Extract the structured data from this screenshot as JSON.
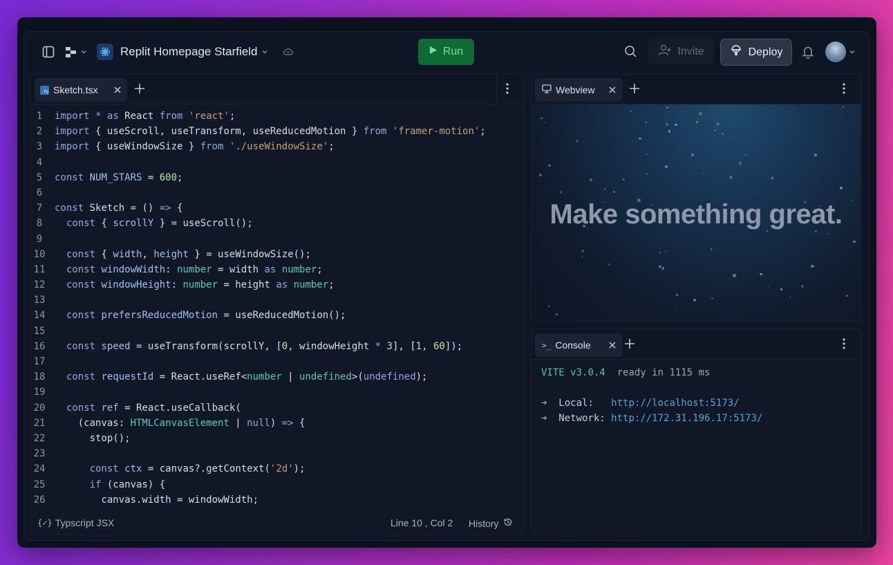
{
  "topbar": {
    "project_name": "Replit Homepage Starfield",
    "run_label": "Run",
    "invite_label": "Invite",
    "deploy_label": "Deploy"
  },
  "editor": {
    "tab_label": "Sketch.tsx",
    "language": "Typscript JSX",
    "cursor": "Line 10 , Col 2",
    "history_label": "History",
    "line_numbers": [
      "1",
      "2",
      "3",
      "4",
      "5",
      "6",
      "7",
      "8",
      "9",
      "10",
      "11",
      "12",
      "13",
      "14",
      "15",
      "16",
      "17",
      "18",
      "19",
      "20",
      "21",
      "22",
      "23",
      "24",
      "25",
      "26"
    ],
    "lines": [
      [
        [
          "kw",
          "import"
        ],
        [
          "pl",
          " "
        ],
        [
          "op",
          "*"
        ],
        [
          "pl",
          " "
        ],
        [
          "kw",
          "as"
        ],
        [
          "pl",
          " React "
        ],
        [
          "kw",
          "from"
        ],
        [
          "pl",
          " "
        ],
        [
          "str",
          "'react'"
        ],
        [
          "pl",
          ";"
        ]
      ],
      [
        [
          "kw",
          "import"
        ],
        [
          "pl",
          " { useScroll, useTransform, useReducedMotion } "
        ],
        [
          "kw",
          "from"
        ],
        [
          "pl",
          " "
        ],
        [
          "str",
          "'framer-motion'"
        ],
        [
          "pl",
          ";"
        ]
      ],
      [
        [
          "kw",
          "import"
        ],
        [
          "pl",
          " { useWindowSize } "
        ],
        [
          "kw",
          "from"
        ],
        [
          "pl",
          " "
        ],
        [
          "str",
          "'./useWindowSize'"
        ],
        [
          "pl",
          ";"
        ]
      ],
      [],
      [
        [
          "kw",
          "const"
        ],
        [
          "pl",
          " "
        ],
        [
          "vr",
          "NUM_STARS"
        ],
        [
          "pl",
          " = "
        ],
        [
          "num",
          "600"
        ],
        [
          "pl",
          ";"
        ]
      ],
      [],
      [
        [
          "kw",
          "const"
        ],
        [
          "pl",
          " Sketch = () "
        ],
        [
          "op",
          "=>"
        ],
        [
          "pl",
          " {"
        ]
      ],
      [
        [
          "pl",
          "  "
        ],
        [
          "kw",
          "const"
        ],
        [
          "pl",
          " { "
        ],
        [
          "vr",
          "scrollY"
        ],
        [
          "pl",
          " } = useScroll();"
        ]
      ],
      [],
      [
        [
          "pl",
          "  "
        ],
        [
          "kw",
          "const"
        ],
        [
          "pl",
          " { "
        ],
        [
          "vr",
          "width"
        ],
        [
          "pl",
          ", "
        ],
        [
          "vr",
          "height"
        ],
        [
          "pl",
          " } = useWindowSize();"
        ]
      ],
      [
        [
          "pl",
          "  "
        ],
        [
          "kw",
          "const"
        ],
        [
          "pl",
          " "
        ],
        [
          "vr",
          "windowWidth"
        ],
        [
          "pl",
          ": "
        ],
        [
          "ty",
          "number"
        ],
        [
          "pl",
          " = width "
        ],
        [
          "kw",
          "as"
        ],
        [
          "pl",
          " "
        ],
        [
          "ty",
          "number"
        ],
        [
          "pl",
          ";"
        ]
      ],
      [
        [
          "pl",
          "  "
        ],
        [
          "kw",
          "const"
        ],
        [
          "pl",
          " "
        ],
        [
          "vr",
          "windowHeight"
        ],
        [
          "pl",
          ": "
        ],
        [
          "ty",
          "number"
        ],
        [
          "pl",
          " = height "
        ],
        [
          "kw",
          "as"
        ],
        [
          "pl",
          " "
        ],
        [
          "ty",
          "number"
        ],
        [
          "pl",
          ";"
        ]
      ],
      [],
      [
        [
          "pl",
          "  "
        ],
        [
          "kw",
          "const"
        ],
        [
          "pl",
          " "
        ],
        [
          "vr",
          "prefersReducedMotion"
        ],
        [
          "pl",
          " = useReducedMotion();"
        ]
      ],
      [],
      [
        [
          "pl",
          "  "
        ],
        [
          "kw",
          "const"
        ],
        [
          "pl",
          " "
        ],
        [
          "vr",
          "speed"
        ],
        [
          "pl",
          " = useTransform(scrollY, ["
        ],
        [
          "num",
          "0"
        ],
        [
          "pl",
          ", windowHeight "
        ],
        [
          "op",
          "*"
        ],
        [
          "pl",
          " "
        ],
        [
          "num",
          "3"
        ],
        [
          "pl",
          "], ["
        ],
        [
          "num",
          "1"
        ],
        [
          "pl",
          ", "
        ],
        [
          "num",
          "60"
        ],
        [
          "pl",
          "]);"
        ]
      ],
      [],
      [
        [
          "pl",
          "  "
        ],
        [
          "kw",
          "const"
        ],
        [
          "pl",
          " "
        ],
        [
          "vr",
          "requestId"
        ],
        [
          "pl",
          " = React.useRef<"
        ],
        [
          "ty",
          "number"
        ],
        [
          "pl",
          " | "
        ],
        [
          "ty",
          "undefined"
        ],
        [
          "pl",
          ">("
        ],
        [
          "kw",
          "undefined"
        ],
        [
          "pl",
          ");"
        ]
      ],
      [],
      [
        [
          "pl",
          "  "
        ],
        [
          "kw",
          "const"
        ],
        [
          "pl",
          " "
        ],
        [
          "vr",
          "ref"
        ],
        [
          "pl",
          " = React.useCallback("
        ]
      ],
      [
        [
          "pl",
          "    (canvas: "
        ],
        [
          "ty",
          "HTMLCanvasElement"
        ],
        [
          "pl",
          " | "
        ],
        [
          "kw",
          "null"
        ],
        [
          "pl",
          ") "
        ],
        [
          "op",
          "=>"
        ],
        [
          "pl",
          " {"
        ]
      ],
      [
        [
          "pl",
          "      stop();"
        ]
      ],
      [],
      [
        [
          "pl",
          "      "
        ],
        [
          "kw",
          "const"
        ],
        [
          "pl",
          " "
        ],
        [
          "vr",
          "ctx"
        ],
        [
          "pl",
          " = canvas?.getContext("
        ],
        [
          "str",
          "'2d'"
        ],
        [
          "pl",
          ");"
        ]
      ],
      [
        [
          "pl",
          "      "
        ],
        [
          "kw",
          "if"
        ],
        [
          "pl",
          " (canvas) {"
        ]
      ],
      [
        [
          "pl",
          "        canvas.width = windowWidth;"
        ]
      ]
    ]
  },
  "webview": {
    "tab_label": "Webview",
    "headline": "Make something great."
  },
  "console": {
    "tab_label": "Console",
    "vite_name": "VITE",
    "vite_version": "v3.0.4",
    "ready_text": "ready in 1115 ms",
    "arrow": "➜",
    "local_label": "Local:",
    "local_url": "http://localhost:5173/",
    "network_label": "Network:",
    "network_url": "http://172.31.196.17:5173/"
  },
  "colors": {
    "run_bg": "#0f6b34",
    "run_text": "#6fe39a",
    "vite": "#4ec4a5",
    "link": "#4fa5d8"
  },
  "icons": [
    "sidebar-toggle-icon",
    "workspace-switcher-icon",
    "project-logo-icon",
    "chevron-down-icon",
    "cloud-sync-icon",
    "play-icon",
    "search-icon",
    "add-person-icon",
    "deploy-icon",
    "bell-icon",
    "avatar",
    "ts-file-icon",
    "close-icon",
    "plus-icon",
    "more-vertical-icon",
    "curly-braces-icon",
    "history-icon",
    "monitor-icon",
    "terminal-icon"
  ]
}
